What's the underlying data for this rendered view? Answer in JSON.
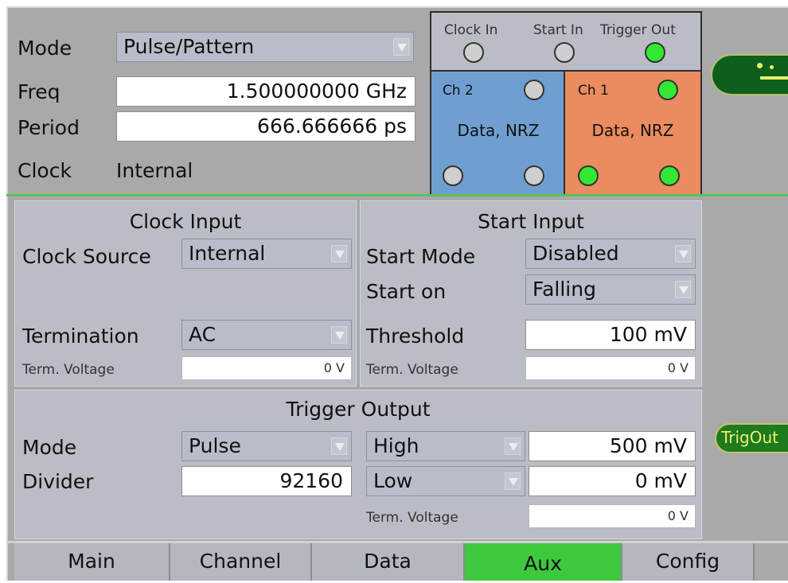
{
  "header": {
    "mode_label": "Mode",
    "mode_value": "Pulse/Pattern",
    "freq_label": "Freq",
    "freq_value": "1.500000000 GHz",
    "period_label": "Period",
    "period_value": "666.666666 ps",
    "clock_label": "Clock",
    "clock_value": "Internal"
  },
  "connectors": {
    "clock_in": "Clock In",
    "start_in": "Start In",
    "trigger_out": "Trigger Out",
    "ch2_label": "Ch 2",
    "ch2_mode": "Data, NRZ",
    "ch1_label": "Ch 1",
    "ch1_mode": "Data, NRZ",
    "ch2_color": "#6f9fd0",
    "ch1_color": "#ea8b60",
    "led_on_color": "#33e833"
  },
  "clock_input": {
    "title": "Clock Input",
    "source_label": "Clock Source",
    "source_value": "Internal",
    "termination_label": "Termination",
    "termination_value": "AC",
    "term_voltage_label": "Term. Voltage",
    "term_voltage_value": "0 V"
  },
  "start_input": {
    "title": "Start Input",
    "mode_label": "Start Mode",
    "mode_value": "Disabled",
    "start_on_label": "Start on",
    "start_on_value": "Falling",
    "threshold_label": "Threshold",
    "threshold_value": "100 mV",
    "term_voltage_label": "Term. Voltage",
    "term_voltage_value": "0 V"
  },
  "trigger_output": {
    "title": "Trigger Output",
    "mode_label": "Mode",
    "mode_value": "Pulse",
    "divider_label": "Divider",
    "divider_value": "92160",
    "high_label": "High",
    "high_value": "500 mV",
    "low_label": "Low",
    "low_value": "0 mV",
    "term_voltage_label": "Term. Voltage",
    "term_voltage_value": "0 V",
    "trigout_badge": "TrigOut"
  },
  "tabs": [
    {
      "label": "Main",
      "active": false
    },
    {
      "label": "Channel",
      "active": false
    },
    {
      "label": "Data",
      "active": false
    },
    {
      "label": "Aux",
      "active": true
    },
    {
      "label": "Config",
      "active": false
    }
  ]
}
